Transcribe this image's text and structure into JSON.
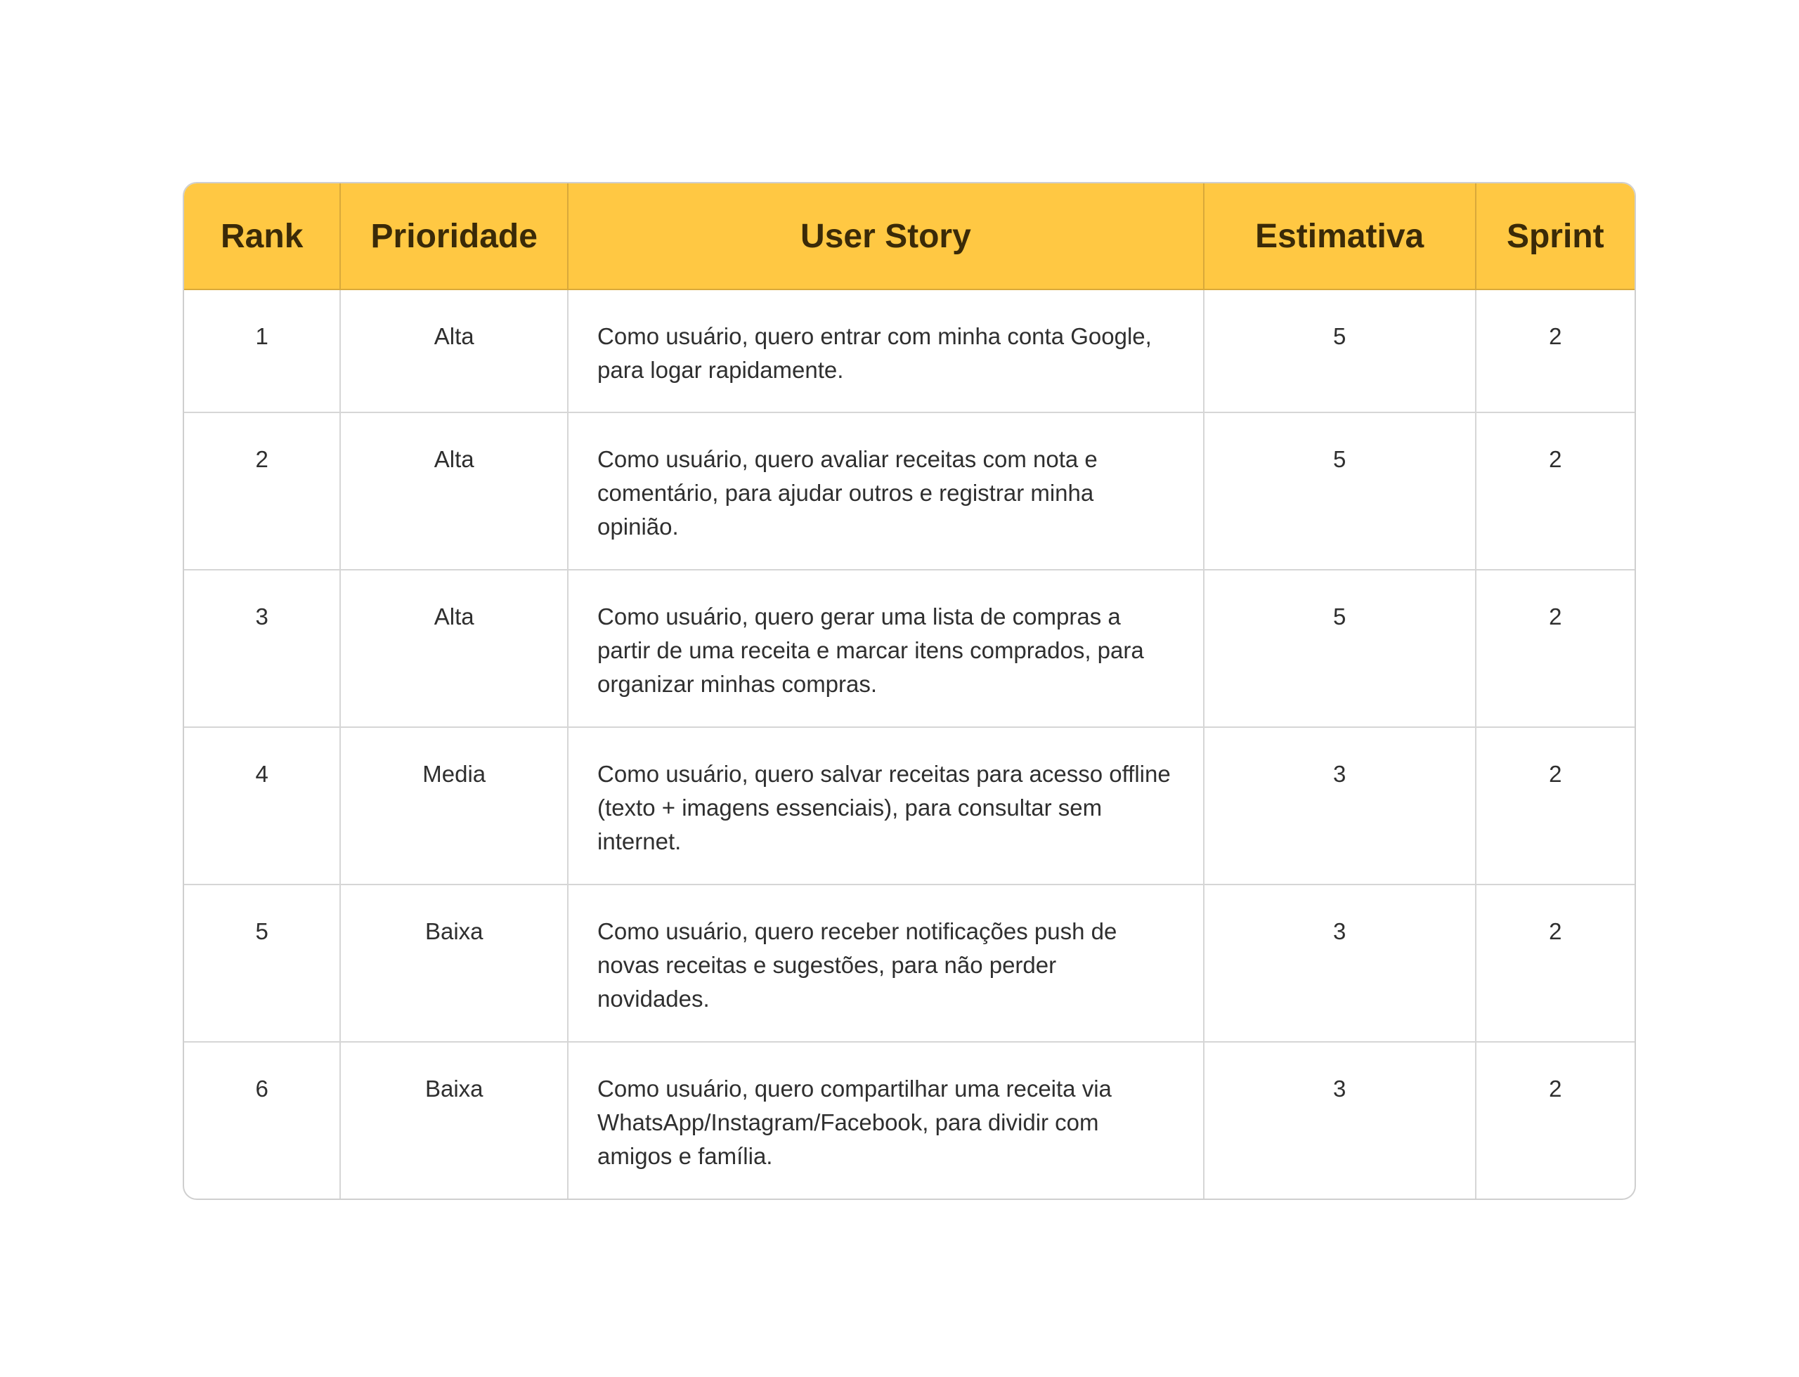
{
  "colors": {
    "header_bg": "#ffc843",
    "header_text": "#3a2a08",
    "border": "#d6d6d6"
  },
  "table": {
    "headers": [
      "Rank",
      "Prioridade",
      "User Story",
      "Estimativa",
      "Sprint"
    ],
    "rows": [
      {
        "rank": "1",
        "prioridade": "Alta",
        "story": "Como usuário, quero entrar com minha conta Google, para logar rapidamente.",
        "estimativa": "5",
        "sprint": "2"
      },
      {
        "rank": "2",
        "prioridade": "Alta",
        "story": "Como usuário, quero avaliar receitas com nota e comentário, para ajudar outros e registrar minha opinião.",
        "estimativa": "5",
        "sprint": "2"
      },
      {
        "rank": "3",
        "prioridade": "Alta",
        "story": "Como usuário, quero gerar uma lista de compras a partir de uma receita e marcar itens comprados, para organizar minhas compras.",
        "estimativa": "5",
        "sprint": "2"
      },
      {
        "rank": "4",
        "prioridade": "Media",
        "story": "Como usuário, quero salvar receitas para acesso offline (texto + imagens essenciais), para consultar sem internet.",
        "estimativa": "3",
        "sprint": "2"
      },
      {
        "rank": "5",
        "prioridade": "Baixa",
        "story": "Como usuário, quero receber notificações push de novas receitas e sugestões, para não perder novidades.",
        "estimativa": "3",
        "sprint": "2"
      },
      {
        "rank": "6",
        "prioridade": "Baixa",
        "story": "Como usuário, quero compartilhar uma receita via WhatsApp/Instagram/Facebook, para dividir com amigos e família.",
        "estimativa": "3",
        "sprint": "2"
      }
    ]
  }
}
